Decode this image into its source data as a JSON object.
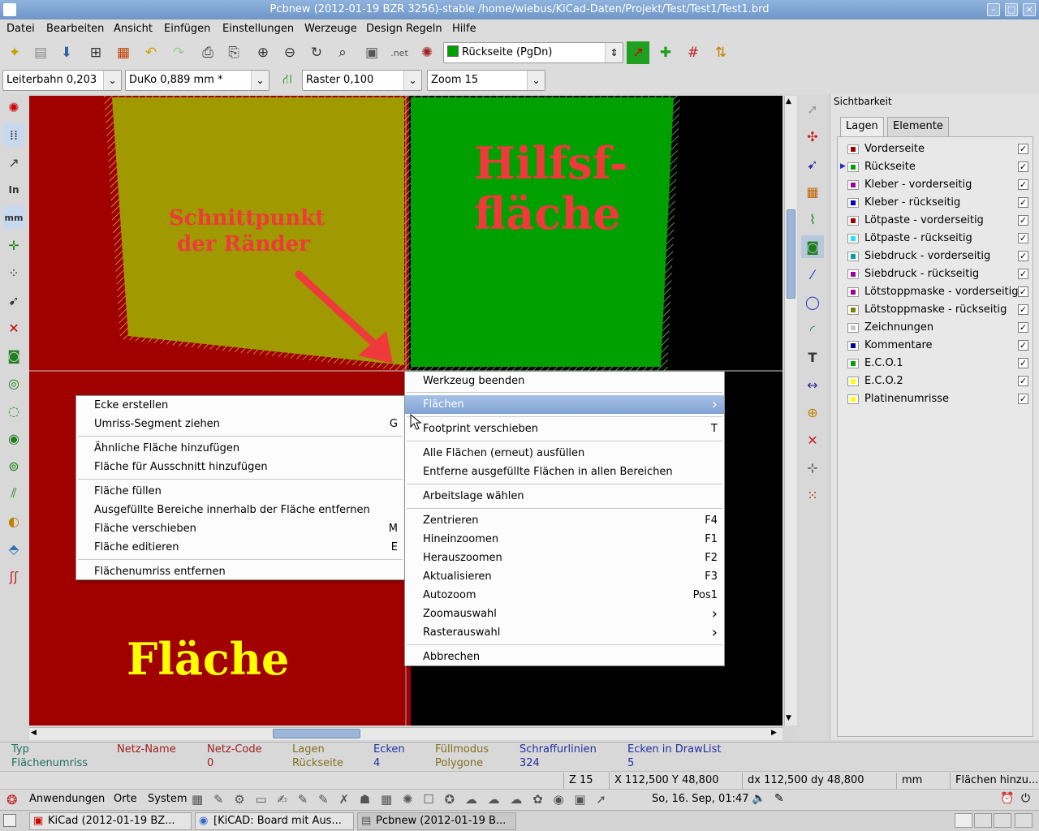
{
  "window": {
    "title": "Pcbnew (2012-01-19 BZR 3256)-stable /home/wiebus/KiCad-Daten/Projekt/Test/Test1/Test1.brd"
  },
  "menubar": [
    "Datei",
    "Bearbeiten",
    "Ansicht",
    "Einfügen",
    "Einstellungen",
    "Werzeuge",
    "Design Regeln",
    "Hilfe"
  ],
  "toolbar": {
    "layer_select": "Rückseite (PgDn)"
  },
  "aux_toolbar": {
    "track": "Leiterbahn 0,203",
    "via": "DuKo 0,889 mm *",
    "grid": "Raster 0,100",
    "zoom": "Zoom 15"
  },
  "canvas": {
    "label_intersection_1": "Schnittpunkt",
    "label_intersection_2": "der Ränder",
    "label_aux_1": "Hilfsf-",
    "label_aux_2": "fläche",
    "label_area": "Fläche",
    "colors": {
      "background": "#000000",
      "zone_red": "#a00000",
      "zone_olive": "#a09a00",
      "zone_green": "#00a000",
      "annotation": "#ee3a3a",
      "title_yellow": "#ffff00"
    }
  },
  "context_menu_left": {
    "items": [
      {
        "label": "Ecke erstellen",
        "key": ""
      },
      {
        "label": "Umriss-Segment ziehen",
        "key": "G"
      },
      {
        "label": "Ähnliche Fläche hinzufügen",
        "key": ""
      },
      {
        "label": "Fläche für Ausschnitt hinzufügen",
        "key": ""
      },
      {
        "label": "Fläche füllen",
        "key": ""
      },
      {
        "label": "Ausgefüllte Bereiche innerhalb der Fläche entfernen",
        "key": ""
      },
      {
        "label": "Fläche verschieben",
        "key": "M"
      },
      {
        "label": "Fläche editieren",
        "key": "E"
      },
      {
        "label": "Flächenumriss entfernen",
        "key": ""
      }
    ]
  },
  "context_menu_right": {
    "items": [
      {
        "label": "Werkzeug beenden",
        "key": ""
      },
      {
        "label": "Flächen",
        "key": "›"
      },
      {
        "label": "Footprint verschieben",
        "key": "T"
      },
      {
        "label": "Alle Flächen (erneut) ausfüllen",
        "key": ""
      },
      {
        "label": "Entferne ausgefüllte Flächen in allen Bereichen",
        "key": ""
      },
      {
        "label": "Arbeitslage wählen",
        "key": ""
      },
      {
        "label": "Zentrieren",
        "key": "F4"
      },
      {
        "label": "Hineinzoomen",
        "key": "F1"
      },
      {
        "label": "Herauszoomen",
        "key": "F2"
      },
      {
        "label": "Aktualisieren",
        "key": "F3"
      },
      {
        "label": "Autozoom",
        "key": "Pos1"
      },
      {
        "label": "Zoomauswahl",
        "key": "›"
      },
      {
        "label": "Rasterauswahl",
        "key": "›"
      },
      {
        "label": "Abbrechen",
        "key": ""
      }
    ]
  },
  "visibility_panel": {
    "title": "Sichtbarkeit",
    "tabs": [
      "Lagen",
      "Elemente"
    ],
    "layers": [
      {
        "name": "Vorderseite",
        "color": "#a00000",
        "checked": "✓"
      },
      {
        "name": "Rückseite",
        "color": "#00a000",
        "checked": "✓"
      },
      {
        "name": "Kleber - vorderseitig",
        "color": "#a000a0",
        "checked": "✓"
      },
      {
        "name": "Kleber - rückseitig",
        "color": "#0000c0",
        "checked": "✓"
      },
      {
        "name": "Lötpaste - vorderseitig",
        "color": "#a00000",
        "checked": "✓"
      },
      {
        "name": "Lötpaste - rückseitig",
        "color": "#20e0ff",
        "checked": "✓"
      },
      {
        "name": "Siebdruck - vorderseitig",
        "color": "#00a0a0",
        "checked": "✓"
      },
      {
        "name": "Siebdruck - rückseitig",
        "color": "#a000a0",
        "checked": "✓"
      },
      {
        "name": "Lötstoppmaske - vorderseitig",
        "color": "#a000a0",
        "checked": "✓"
      },
      {
        "name": "Lötstoppmaske - rückseitig",
        "color": "#808000",
        "checked": "✓"
      },
      {
        "name": "Zeichnungen",
        "color": "#c8c8c8",
        "checked": "✓"
      },
      {
        "name": "Kommentare",
        "color": "#0000a0",
        "checked": "✓"
      },
      {
        "name": "E.C.O.1",
        "color": "#00a000",
        "checked": "✓"
      },
      {
        "name": "E.C.O.2",
        "color": "#ffff00",
        "checked": "✓"
      },
      {
        "name": "Platinenumrisse",
        "color": "#ffff00",
        "checked": "✓"
      }
    ]
  },
  "info_panel": {
    "typ_h": "Typ",
    "typ_v": "Flächenumriss",
    "netname_h": "Netz-Name",
    "netname_v": "",
    "netcode_h": "Netz-Code",
    "netcode_v": "0",
    "layer_h": "Lagen",
    "layer_v": "Rückseite",
    "corners_h": "Ecken",
    "corners_v": "4",
    "fill_h": "Füllmodus",
    "fill_v": "Polygone",
    "hatch_h": "Schraffurlinien",
    "hatch_v": "324",
    "drawlist_h": "Ecken in DrawList",
    "drawlist_v": "5"
  },
  "statusbar": {
    "zoom": "Z 15",
    "abs": "X 112,500  Y 48,800",
    "rel": "dx 112,500  dy 48,800",
    "units": "mm",
    "msg": "Flächen hinzu..."
  },
  "gnome": {
    "apps": "Anwendungen",
    "places": "Orte",
    "system": "System",
    "clock": "So, 16. Sep, 01:47",
    "tasks": [
      "KiCad (2012-01-19 BZ...",
      "[KiCAD: Board mit Aus...",
      "Pcbnew (2012-01-19 B..."
    ]
  }
}
